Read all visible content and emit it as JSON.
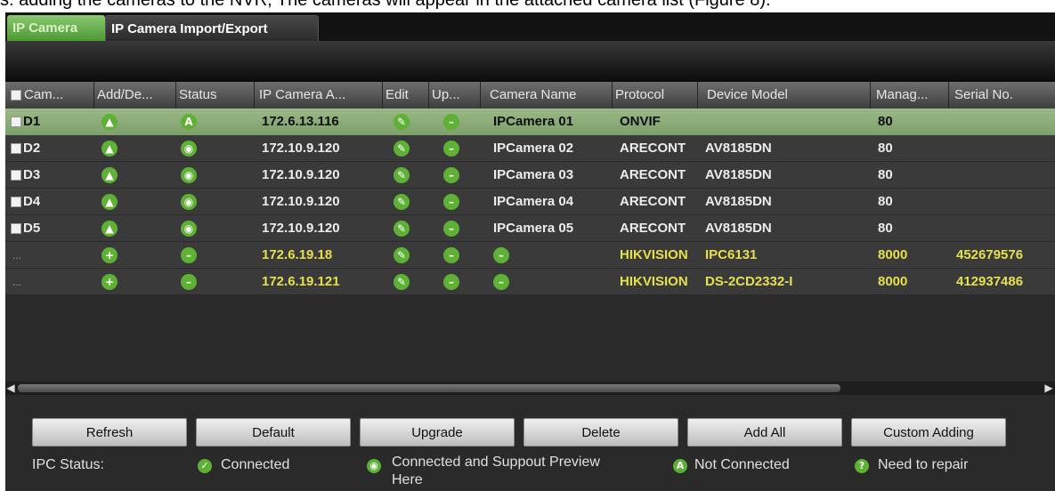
{
  "caption": "s: adding the cameras to the NVR, The cameras will appear in the attached camera list (Figure 8).",
  "tabs": [
    {
      "label": "IP Camera",
      "active": true
    },
    {
      "label": "IP Camera Import/Export",
      "active": false
    }
  ],
  "table": {
    "headers": [
      "Cam...",
      "Add/De...",
      "Status",
      "IP Camera A...",
      "Edit",
      "Up...",
      "Camera Name",
      "Protocol",
      "Device Model",
      "Manag...",
      "Serial No."
    ],
    "rows": [
      {
        "cam": "D1",
        "ip": "172.6.13.116",
        "name": "IPCamera 01",
        "protocol": "ONVIF",
        "model": "",
        "port": "80",
        "serial": "",
        "status_icon": "not-connected-icon"
      },
      {
        "cam": "D2",
        "ip": "172.10.9.120",
        "name": "IPCamera 02",
        "protocol": "ARECONT",
        "model": "AV8185DN",
        "port": "80",
        "serial": "",
        "status_icon": "connected-preview-icon"
      },
      {
        "cam": "D3",
        "ip": "172.10.9.120",
        "name": "IPCamera 03",
        "protocol": "ARECONT",
        "model": "AV8185DN",
        "port": "80",
        "serial": "",
        "status_icon": "connected-preview-icon"
      },
      {
        "cam": "D4",
        "ip": "172.10.9.120",
        "name": "IPCamera 04",
        "protocol": "ARECONT",
        "model": "AV8185DN",
        "port": "80",
        "serial": "",
        "status_icon": "connected-preview-icon"
      },
      {
        "cam": "D5",
        "ip": "172.10.9.120",
        "name": "IPCamera 05",
        "protocol": "ARECONT",
        "model": "AV8185DN",
        "port": "80",
        "serial": "",
        "status_icon": "connected-preview-icon"
      },
      {
        "cam": "...",
        "ip": "172.6.19.18",
        "name": "",
        "protocol": "HIKVISION",
        "model": "IPC6131",
        "port": "8000",
        "serial": "452679576",
        "status_icon": "minus-icon"
      },
      {
        "cam": "...",
        "ip": "172.6.19.121",
        "name": "",
        "protocol": "HIKVISION",
        "model": "DS-2CD2332-I",
        "port": "8000",
        "serial": "412937486",
        "status_icon": "minus-icon"
      }
    ]
  },
  "buttons": [
    "Refresh",
    "Default",
    "Upgrade",
    "Delete",
    "Add All",
    "Custom Adding"
  ],
  "legend": {
    "title": "IPC Status:",
    "items": [
      {
        "label": "Connected",
        "icon": "connected-icon"
      },
      {
        "label": "Connected and Suppout Preview Here",
        "icon": "connected-preview-icon"
      },
      {
        "label": "Not Connected",
        "icon": "not-connected-icon"
      },
      {
        "label": "Need to repair",
        "icon": "need-repair-icon"
      }
    ]
  },
  "colors": {
    "accent_green": "#5fb135",
    "selected_row": "#8aac78",
    "unadded_text": "#e6e04c"
  }
}
